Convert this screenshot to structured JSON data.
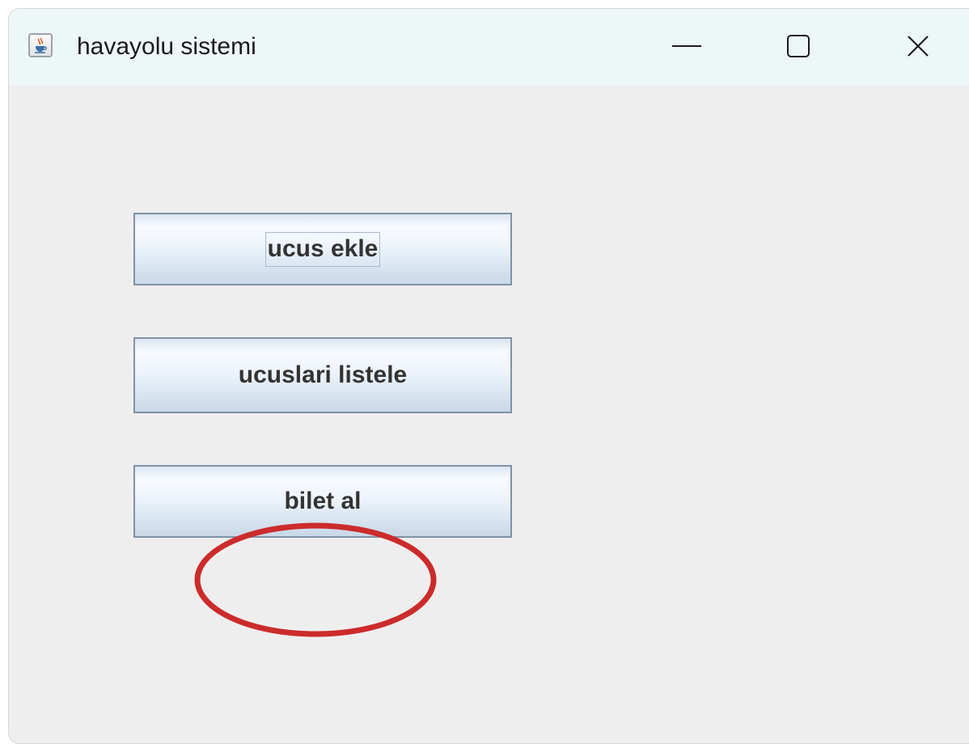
{
  "window": {
    "title": "havayolu sistemi",
    "icon": "java-cup-icon",
    "controls": {
      "minimize_icon": "minimize-icon",
      "maximize_icon": "maximize-icon",
      "close_icon": "close-icon"
    }
  },
  "buttons": {
    "ucus_ekle": "ucus ekle",
    "ucuslari_listele": "ucuslari listele",
    "bilet_al": "bilet al"
  },
  "annotation": {
    "highlight_color": "#cc2b2b",
    "highlighted_button": "bilet al"
  }
}
